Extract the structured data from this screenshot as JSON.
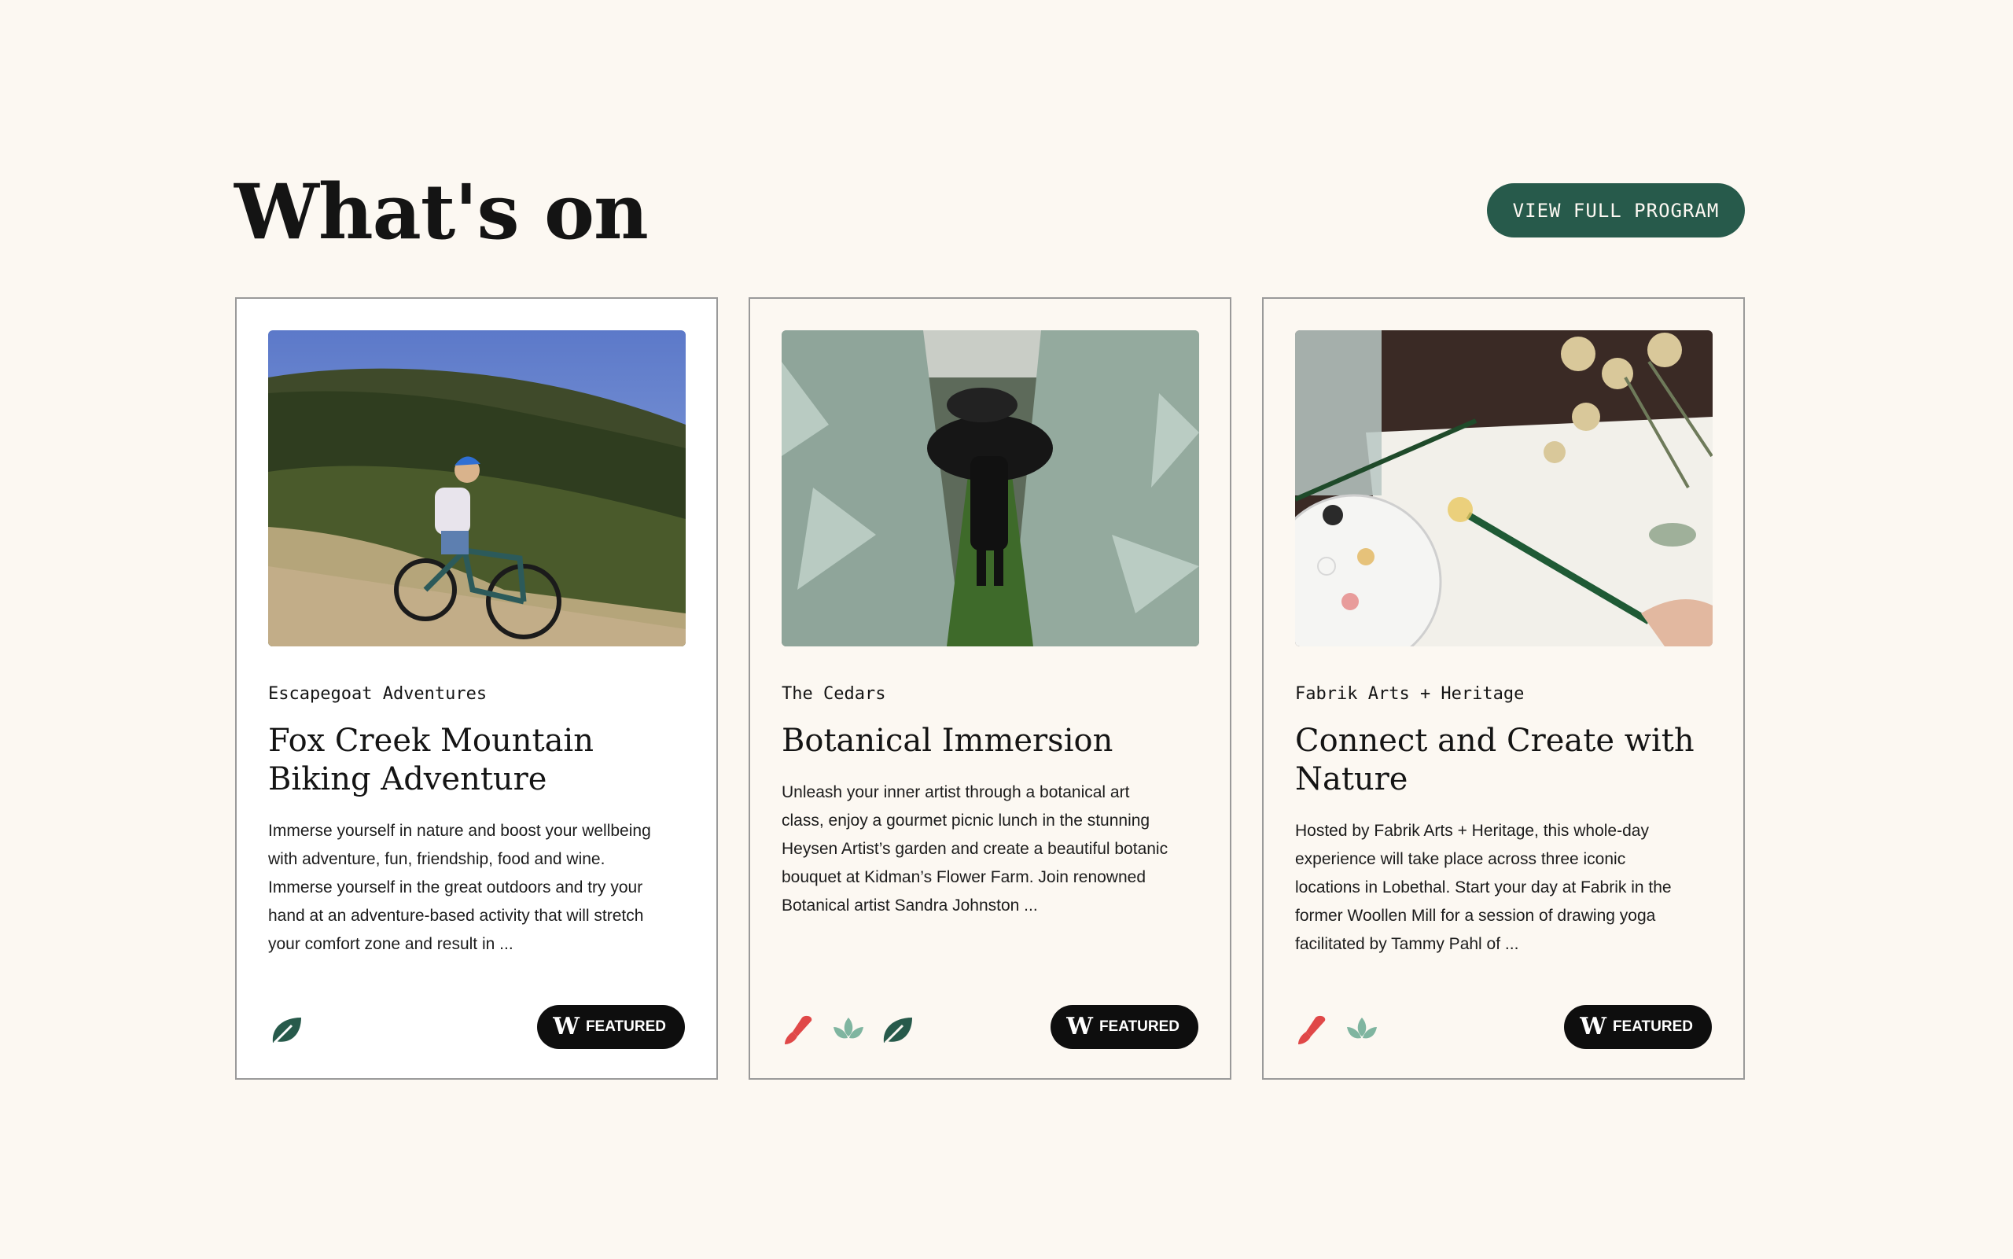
{
  "header": {
    "title": "What's on",
    "cta_label": "VIEW FULL PROGRAM"
  },
  "cards": [
    {
      "organizer": "Escapegoat Adventures",
      "title": "Fox Creek Mountain Biking Adventure",
      "description": "Immerse yourself in nature and boost your wellbeing with adventure, fun, friendship, food and wine. Immerse yourself in the great outdoors and try your hand at an adventure-based activity that will stretch your comfort zone and result in ...",
      "image": "woman-mountain-biking-on-hillside",
      "icons": [
        "leaf-icon"
      ],
      "badge": "FEATURED"
    },
    {
      "organizer": "The Cedars",
      "title": "Botanical Immersion",
      "description": "Unleash your inner artist through a botanical art class, enjoy a gourmet picnic lunch in the stunning Heysen Artist’s garden and create a beautiful botanic bouquet at Kidman’s Flower Farm. Join renowned Botanical artist Sandra Johnston ...",
      "image": "people-with-umbrellas-walking-between-eucalyptus-rows",
      "icons": [
        "paintbrush-icon",
        "lotus-icon",
        "leaf-icon"
      ],
      "badge": "FEATURED"
    },
    {
      "organizer": "Fabrik Arts + Heritage",
      "title": "Connect and Create with Nature",
      "description": "Hosted by Fabrik Arts + Heritage, this whole-day experience will take place across three iconic locations in Lobethal. Start your day at Fabrik in the former Woollen Mill for a session of drawing yoga facilitated by Tammy Pahl of ...",
      "image": "hand-painting-dried-flowers-with-brush",
      "icons": [
        "paintbrush-icon",
        "lotus-icon"
      ],
      "badge": "FEATURED"
    }
  ],
  "badge_logo": "W",
  "colors": {
    "background": "#fcf8f2",
    "accent": "#275a4b",
    "badge": "#0e0e0e",
    "paintbrush": "#e04848",
    "lotus": "#7fb5a0",
    "leaf": "#275a4b"
  }
}
